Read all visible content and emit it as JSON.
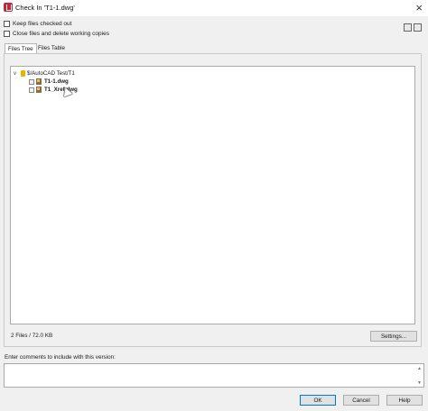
{
  "window": {
    "title": "Check In 'T1-1.dwg'"
  },
  "options": {
    "keep_checked_out": "Keep files checked out",
    "close_and_delete": "Close files and delete working copies"
  },
  "tabs": [
    {
      "label": "Files Tree",
      "active": true
    },
    {
      "label": "Files Table",
      "active": false
    }
  ],
  "tree": {
    "root": "$/AutoCAD Test/T1",
    "files": [
      {
        "name": "T1-1.dwg"
      },
      {
        "name": "T1_Xref.dwg"
      }
    ]
  },
  "status": "2 Files / 72.0 KB",
  "buttons": {
    "settings": "Settings...",
    "ok": "OK",
    "cancel": "Cancel",
    "help": "Help"
  },
  "comments": {
    "label": "Enter comments to include with this version:"
  },
  "colors": {
    "app_icon": "#c0283e",
    "primary_border": "#0078d7"
  }
}
